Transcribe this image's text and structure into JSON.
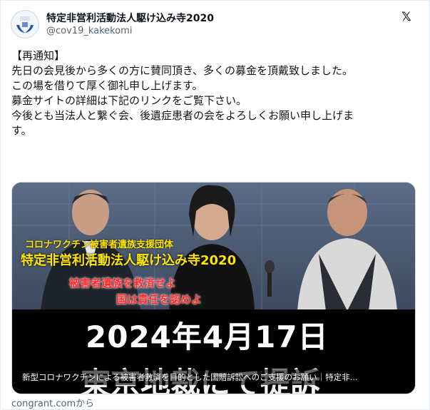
{
  "account": {
    "name": "特定非営利活動法人駆け込み寺2020",
    "handle": "@cov19_kakekomi"
  },
  "header": {
    "logo_glyph": "𝕏"
  },
  "tweet": {
    "lines": [
      "【再通知】",
      "先日の会見後から多くの方に賛同頂き、多くの募金を頂戴致しました。",
      "この場を借りて厚く御礼申し上げます。",
      "",
      "募金サイトの詳細は下記のリンクをご覧下さい。",
      "今後とも当法人と繋ぐ会、後遺症患者の会をよろしくお願い申し上げま",
      "す。"
    ]
  },
  "card": {
    "overlay": {
      "org_label": "コロナワクチン被害者遺族支援団体",
      "org_name": "特定非営利活動法人駆け込み寺2020",
      "slogan1": "被害者遺族を救済せよ",
      "slogan2": "国は責任を認めよ",
      "date": "2024年4月17日",
      "court": "東京地裁にて提訴"
    },
    "caption": "新型コロナワクチンによる被害者救済を目的とした国賠訴訟へのご支援のお願い｜特定非...",
    "source": "congrant.comから"
  },
  "colors": {
    "accent_yellow": "#ffe600",
    "accent_red": "#ff2a2a",
    "text_primary": "#0f1419",
    "text_secondary": "#536471"
  }
}
